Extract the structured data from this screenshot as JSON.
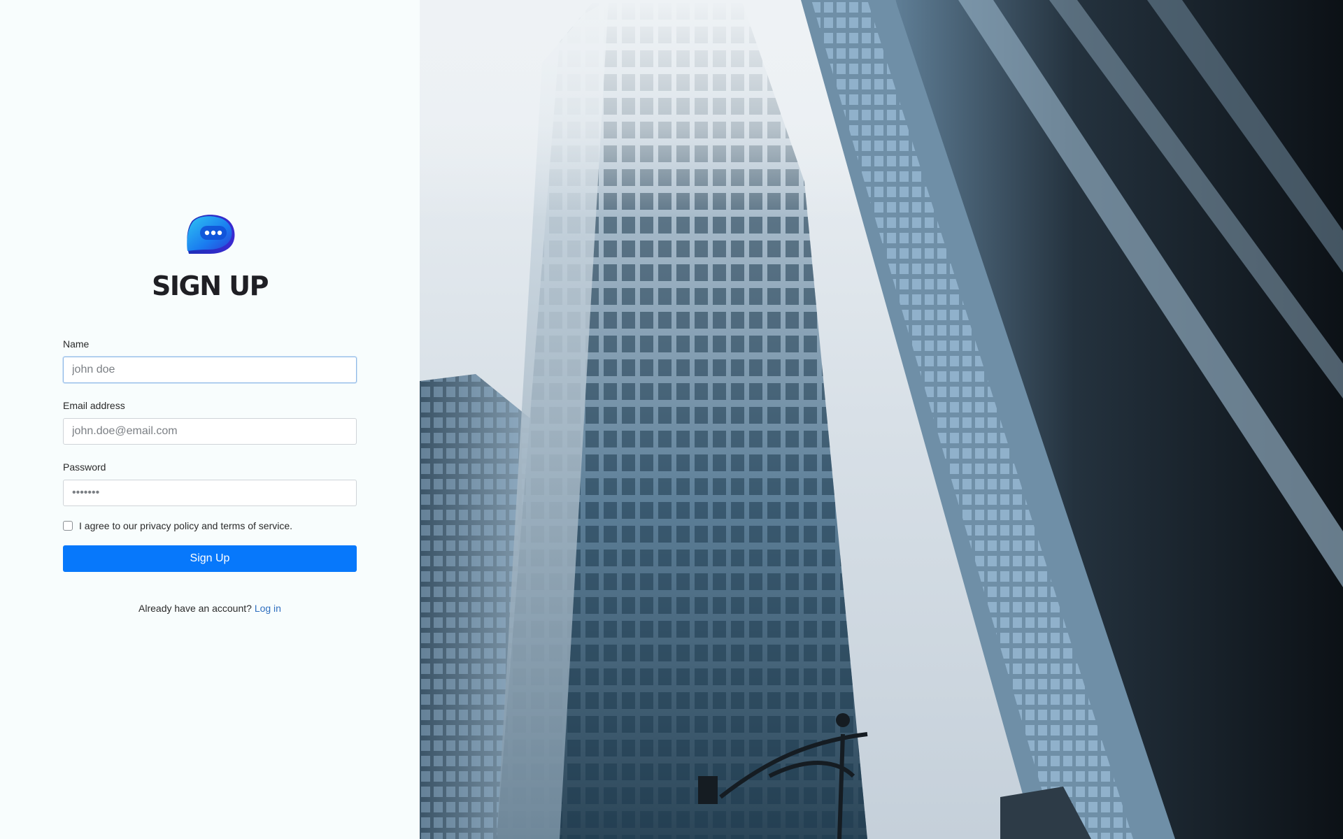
{
  "brand": {
    "logo_icon": "chat-bubble-logo-icon",
    "accent_color": "#0778fb"
  },
  "form": {
    "title": "SIGN UP",
    "name_label": "Name",
    "name_placeholder": "john doe",
    "name_value": "",
    "email_label": "Email address",
    "email_placeholder": "john.doe@email.com",
    "email_value": "",
    "password_label": "Password",
    "password_placeholder": "•••••••",
    "password_value": "",
    "agree_label": "I agree to our privacy policy and terms of service.",
    "agree_checked": false,
    "submit_label": "Sign Up",
    "login_prompt": "Already have an account?",
    "login_link": "Log in"
  },
  "hero": {
    "image": "city-skyscrapers-photo"
  }
}
